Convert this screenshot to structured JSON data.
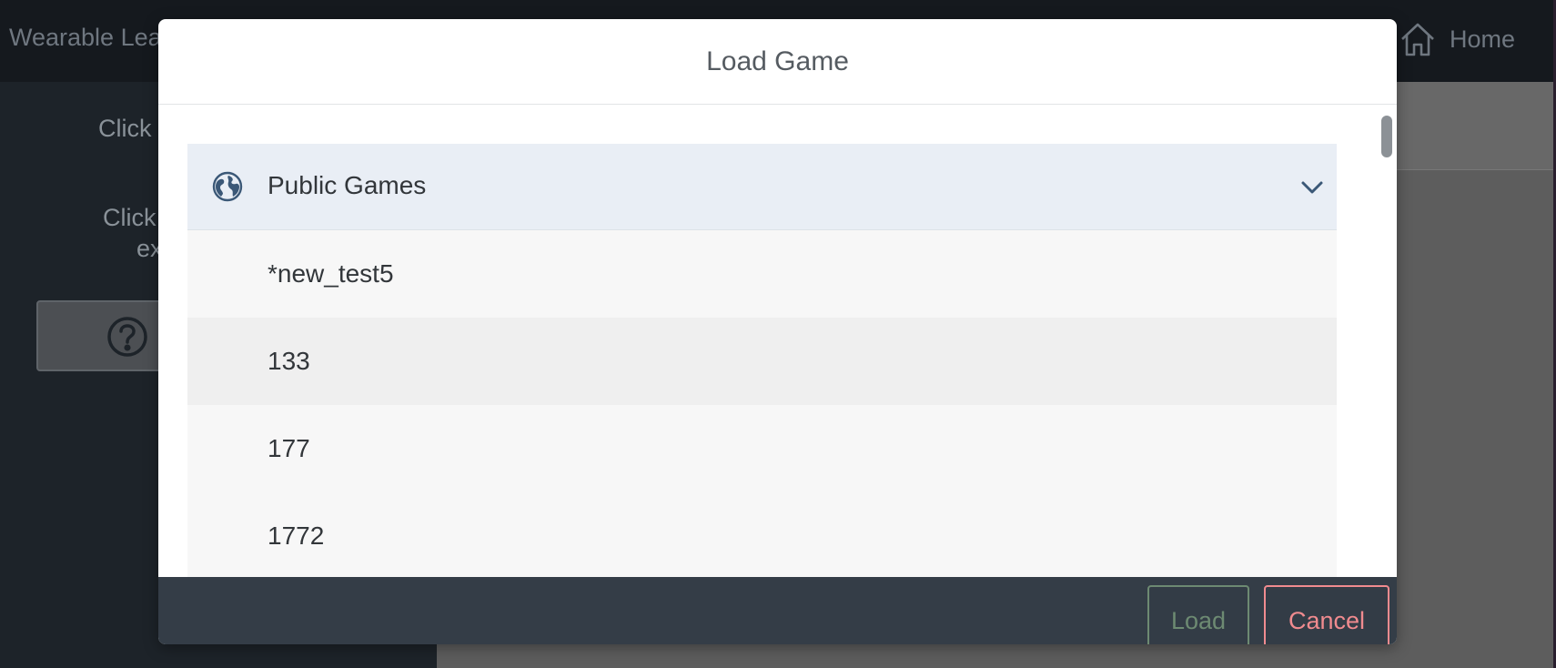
{
  "app": {
    "title": "Wearable Lea",
    "home_label": "Home",
    "sidebar_line1": "Click",
    "sidebar_line2": "Click",
    "sidebar_line3": "ex"
  },
  "modal": {
    "title": "Load Game",
    "group": {
      "label": "Public Games",
      "icon": "globe-icon",
      "expanded": true
    },
    "games": [
      "*new_test5",
      "133",
      "177",
      "1772"
    ],
    "load_label": "Load",
    "cancel_label": "Cancel"
  },
  "colors": {
    "load_accent": "#6d8a72",
    "cancel_accent": "#f08b8f",
    "footer": "#343d47",
    "group_header": "#e9eef5"
  }
}
